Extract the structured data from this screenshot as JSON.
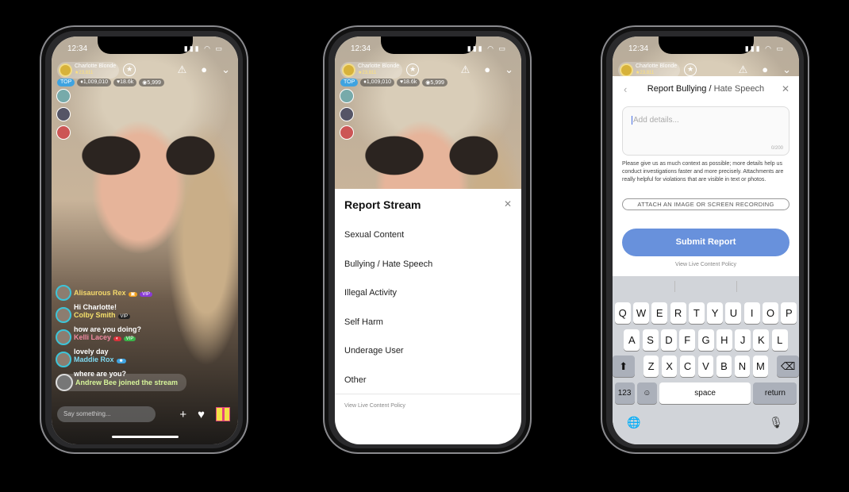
{
  "status": {
    "time": "12:34",
    "icons": "▮▮▮ ◠ ▭"
  },
  "streamer": {
    "name": "Charlotte Blonde",
    "coins": "★23,811"
  },
  "badges": {
    "top": "TOP",
    "diamonds": "♦1,009,010",
    "likes": "♥18.6k",
    "viewers": "◉5,999"
  },
  "chat": [
    {
      "name": "Alisaurous Rex",
      "text": "Hi Charlotte!",
      "color": "#f5d96b",
      "tags": [
        "▣",
        "VIP"
      ],
      "tag_colors": [
        "#f0a020",
        "#8a3ad8"
      ]
    },
    {
      "name": "Colby Smith",
      "text": "how are you doing?",
      "color": "#f5e06b",
      "tags": [
        "VIP"
      ],
      "tag_colors": [
        "#222"
      ]
    },
    {
      "name": "Kelli Lacey",
      "text": "lovely day",
      "color": "#f08aa0",
      "tags": [
        "◐",
        "VIP"
      ],
      "tag_colors": [
        "#d8323a",
        "#3ab44a"
      ]
    },
    {
      "name": "Maddie Rox",
      "text": "where are you?",
      "color": "#7fd8f0",
      "tags": [
        "☻"
      ],
      "tag_colors": [
        "#3fa3e0"
      ]
    }
  ],
  "join_message": "Andrew Bee joined the stream",
  "input_placeholder": "Say something...",
  "report_stream": {
    "title": "Report Stream",
    "close": "✕",
    "items": [
      "Sexual Content",
      "Bullying / Hate Speech",
      "Illegal Activity",
      "Self Harm",
      "Underage User",
      "Other"
    ],
    "policy": "View Live Content Policy"
  },
  "report_detail": {
    "back": "‹",
    "title": "Report Bullying /",
    "subtitle": "Hate Speech",
    "close": "✕",
    "placeholder": "Add details...",
    "counter": "0/200",
    "help": "Please give us as much context as possible; more details help us conduct investigations faster and more precisely. Attachments are really helpful for violations that are visible in text or photos.",
    "attach": "ATTACH AN IMAGE OR SCREEN RECORDING",
    "submit": "Submit Report",
    "policy": "View Live Content Policy",
    "accent": "#6891dc"
  },
  "keyboard": {
    "row1": [
      "Q",
      "W",
      "E",
      "R",
      "T",
      "Y",
      "U",
      "I",
      "O",
      "P"
    ],
    "row2": [
      "A",
      "S",
      "D",
      "F",
      "G",
      "H",
      "J",
      "K",
      "L"
    ],
    "row3": [
      "⬆",
      "Z",
      "X",
      "C",
      "V",
      "B",
      "N",
      "M",
      "⌫"
    ],
    "row4": [
      "123",
      "☺",
      "space",
      "return"
    ],
    "globe": "🌐",
    "mic": "🎙"
  }
}
